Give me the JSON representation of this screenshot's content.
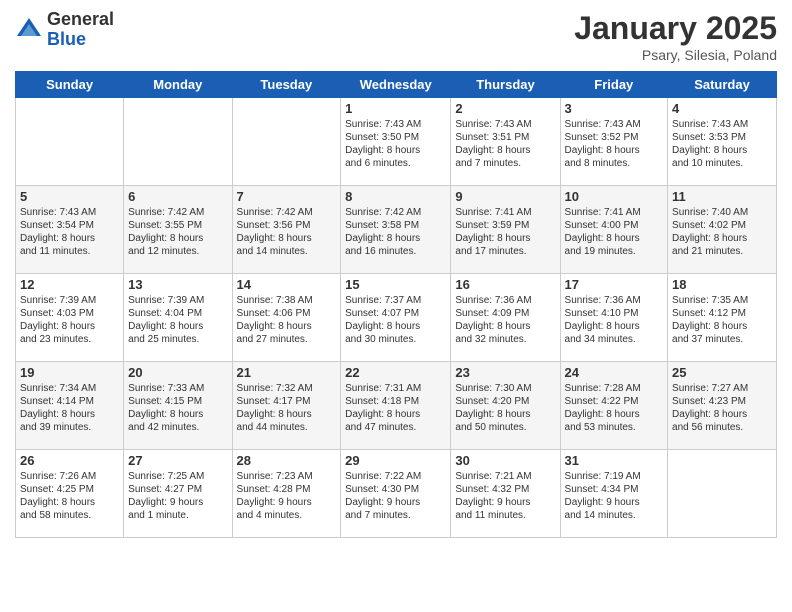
{
  "logo": {
    "general": "General",
    "blue": "Blue"
  },
  "title": "January 2025",
  "location": "Psary, Silesia, Poland",
  "days_header": [
    "Sunday",
    "Monday",
    "Tuesday",
    "Wednesday",
    "Thursday",
    "Friday",
    "Saturday"
  ],
  "weeks": [
    [
      {
        "day": "",
        "info": ""
      },
      {
        "day": "",
        "info": ""
      },
      {
        "day": "",
        "info": ""
      },
      {
        "day": "1",
        "info": "Sunrise: 7:43 AM\nSunset: 3:50 PM\nDaylight: 8 hours\nand 6 minutes."
      },
      {
        "day": "2",
        "info": "Sunrise: 7:43 AM\nSunset: 3:51 PM\nDaylight: 8 hours\nand 7 minutes."
      },
      {
        "day": "3",
        "info": "Sunrise: 7:43 AM\nSunset: 3:52 PM\nDaylight: 8 hours\nand 8 minutes."
      },
      {
        "day": "4",
        "info": "Sunrise: 7:43 AM\nSunset: 3:53 PM\nDaylight: 8 hours\nand 10 minutes."
      }
    ],
    [
      {
        "day": "5",
        "info": "Sunrise: 7:43 AM\nSunset: 3:54 PM\nDaylight: 8 hours\nand 11 minutes."
      },
      {
        "day": "6",
        "info": "Sunrise: 7:42 AM\nSunset: 3:55 PM\nDaylight: 8 hours\nand 12 minutes."
      },
      {
        "day": "7",
        "info": "Sunrise: 7:42 AM\nSunset: 3:56 PM\nDaylight: 8 hours\nand 14 minutes."
      },
      {
        "day": "8",
        "info": "Sunrise: 7:42 AM\nSunset: 3:58 PM\nDaylight: 8 hours\nand 16 minutes."
      },
      {
        "day": "9",
        "info": "Sunrise: 7:41 AM\nSunset: 3:59 PM\nDaylight: 8 hours\nand 17 minutes."
      },
      {
        "day": "10",
        "info": "Sunrise: 7:41 AM\nSunset: 4:00 PM\nDaylight: 8 hours\nand 19 minutes."
      },
      {
        "day": "11",
        "info": "Sunrise: 7:40 AM\nSunset: 4:02 PM\nDaylight: 8 hours\nand 21 minutes."
      }
    ],
    [
      {
        "day": "12",
        "info": "Sunrise: 7:39 AM\nSunset: 4:03 PM\nDaylight: 8 hours\nand 23 minutes."
      },
      {
        "day": "13",
        "info": "Sunrise: 7:39 AM\nSunset: 4:04 PM\nDaylight: 8 hours\nand 25 minutes."
      },
      {
        "day": "14",
        "info": "Sunrise: 7:38 AM\nSunset: 4:06 PM\nDaylight: 8 hours\nand 27 minutes."
      },
      {
        "day": "15",
        "info": "Sunrise: 7:37 AM\nSunset: 4:07 PM\nDaylight: 8 hours\nand 30 minutes."
      },
      {
        "day": "16",
        "info": "Sunrise: 7:36 AM\nSunset: 4:09 PM\nDaylight: 8 hours\nand 32 minutes."
      },
      {
        "day": "17",
        "info": "Sunrise: 7:36 AM\nSunset: 4:10 PM\nDaylight: 8 hours\nand 34 minutes."
      },
      {
        "day": "18",
        "info": "Sunrise: 7:35 AM\nSunset: 4:12 PM\nDaylight: 8 hours\nand 37 minutes."
      }
    ],
    [
      {
        "day": "19",
        "info": "Sunrise: 7:34 AM\nSunset: 4:14 PM\nDaylight: 8 hours\nand 39 minutes."
      },
      {
        "day": "20",
        "info": "Sunrise: 7:33 AM\nSunset: 4:15 PM\nDaylight: 8 hours\nand 42 minutes."
      },
      {
        "day": "21",
        "info": "Sunrise: 7:32 AM\nSunset: 4:17 PM\nDaylight: 8 hours\nand 44 minutes."
      },
      {
        "day": "22",
        "info": "Sunrise: 7:31 AM\nSunset: 4:18 PM\nDaylight: 8 hours\nand 47 minutes."
      },
      {
        "day": "23",
        "info": "Sunrise: 7:30 AM\nSunset: 4:20 PM\nDaylight: 8 hours\nand 50 minutes."
      },
      {
        "day": "24",
        "info": "Sunrise: 7:28 AM\nSunset: 4:22 PM\nDaylight: 8 hours\nand 53 minutes."
      },
      {
        "day": "25",
        "info": "Sunrise: 7:27 AM\nSunset: 4:23 PM\nDaylight: 8 hours\nand 56 minutes."
      }
    ],
    [
      {
        "day": "26",
        "info": "Sunrise: 7:26 AM\nSunset: 4:25 PM\nDaylight: 8 hours\nand 58 minutes."
      },
      {
        "day": "27",
        "info": "Sunrise: 7:25 AM\nSunset: 4:27 PM\nDaylight: 9 hours\nand 1 minute."
      },
      {
        "day": "28",
        "info": "Sunrise: 7:23 AM\nSunset: 4:28 PM\nDaylight: 9 hours\nand 4 minutes."
      },
      {
        "day": "29",
        "info": "Sunrise: 7:22 AM\nSunset: 4:30 PM\nDaylight: 9 hours\nand 7 minutes."
      },
      {
        "day": "30",
        "info": "Sunrise: 7:21 AM\nSunset: 4:32 PM\nDaylight: 9 hours\nand 11 minutes."
      },
      {
        "day": "31",
        "info": "Sunrise: 7:19 AM\nSunset: 4:34 PM\nDaylight: 9 hours\nand 14 minutes."
      },
      {
        "day": "",
        "info": ""
      }
    ]
  ]
}
